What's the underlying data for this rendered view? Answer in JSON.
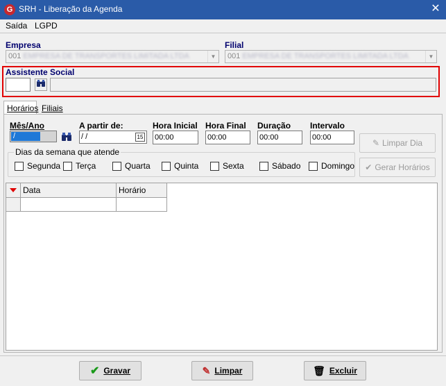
{
  "window": {
    "title": "SRH - Liberação da Agenda",
    "close_glyph": "✕",
    "app_icon": "G"
  },
  "menu": [
    {
      "label": "Saída"
    },
    {
      "label": "LGPD"
    }
  ],
  "empresa": {
    "label": "Empresa",
    "value_prefix": "001",
    "value_blurred": "EMPRESA DE TRANSPORTES LIMITADA LTDA"
  },
  "filial": {
    "label": "Filial",
    "value_prefix": "001",
    "value_blurred": "EMPRESA DE TRANSPORTES LIMITADA LTDA"
  },
  "assistente": {
    "label": "Assistente Social",
    "code_value": "",
    "name_value": ""
  },
  "tabs": [
    {
      "label": "Horários",
      "active": true
    },
    {
      "label": "Filiais",
      "active": false
    }
  ],
  "fields": {
    "mes_ano": {
      "label": "Mês/Ano",
      "value": " /"
    },
    "a_partir": {
      "label": "A partir de:",
      "value": " / /",
      "cal_icon": "15"
    },
    "hora_inicial": {
      "label": "Hora Inicial",
      "value": "00:00"
    },
    "hora_final": {
      "label": "Hora Final",
      "value": "00:00"
    },
    "duracao": {
      "label": "Duração",
      "value": "00:00"
    },
    "intervalo": {
      "label": "Intervalo",
      "value": "00:00"
    }
  },
  "dias": {
    "title": "Dias da semana que atende",
    "items": [
      "Segunda",
      "Terça",
      "Quarta",
      "Quinta",
      "Sexta",
      "Sábado",
      "Domingo"
    ]
  },
  "buttons_side": {
    "limpar_dia": "Limpar Dia",
    "gerar_horarios": "Gerar Horários"
  },
  "grid": {
    "columns": [
      "Data",
      "Horário"
    ]
  },
  "footer": {
    "gravar": "Gravar",
    "limpar": "Limpar",
    "excluir": "Excluir"
  },
  "colors": {
    "titlebar": "#2a5ba8",
    "accent_red": "#e10000",
    "label_blue": "#00006e",
    "selection": "#1e78d7"
  }
}
